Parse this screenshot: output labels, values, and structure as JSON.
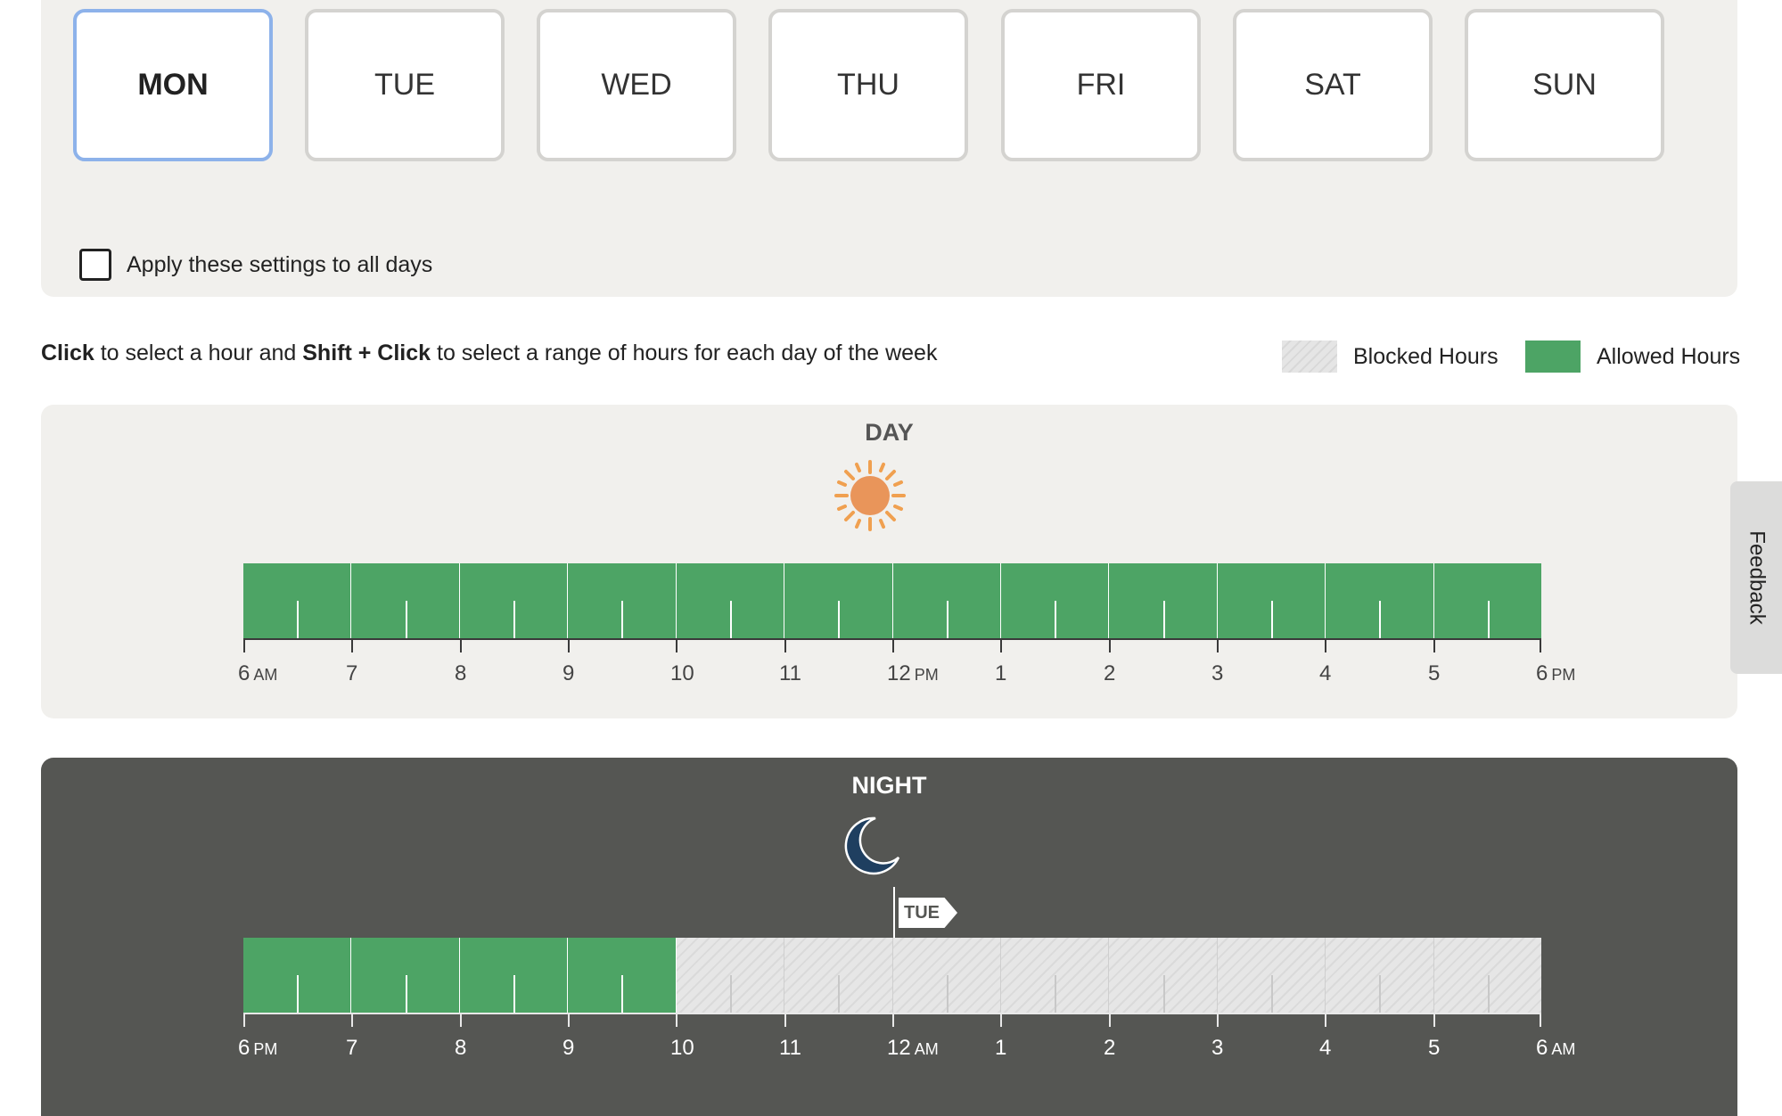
{
  "days": {
    "buttons": [
      {
        "label": "MON",
        "selected": true
      },
      {
        "label": "TUE",
        "selected": false
      },
      {
        "label": "WED",
        "selected": false
      },
      {
        "label": "THU",
        "selected": false
      },
      {
        "label": "FRI",
        "selected": false
      },
      {
        "label": "SAT",
        "selected": false
      },
      {
        "label": "SUN",
        "selected": false
      }
    ],
    "apply_all_label": "Apply these settings to all days",
    "apply_all_checked": false
  },
  "instructions": {
    "click": "Click",
    "part1": " to select a hour and ",
    "shift_click": "Shift + Click",
    "part2": " to select a range of hours for each day of the week"
  },
  "legend": {
    "blocked_label": "Blocked Hours",
    "allowed_label": "Allowed Hours",
    "allowed_color": "#4da465",
    "blocked_color": "#e5e5e5"
  },
  "day_panel": {
    "title": "DAY",
    "icon": "sun-icon",
    "hours": [
      "allowed",
      "allowed",
      "allowed",
      "allowed",
      "allowed",
      "allowed",
      "allowed",
      "allowed",
      "allowed",
      "allowed",
      "allowed",
      "allowed"
    ],
    "tick_labels": [
      {
        "num": "6",
        "ap": "AM"
      },
      {
        "num": "7",
        "ap": ""
      },
      {
        "num": "8",
        "ap": ""
      },
      {
        "num": "9",
        "ap": ""
      },
      {
        "num": "10",
        "ap": ""
      },
      {
        "num": "11",
        "ap": ""
      },
      {
        "num": "12",
        "ap": "PM"
      },
      {
        "num": "1",
        "ap": ""
      },
      {
        "num": "2",
        "ap": ""
      },
      {
        "num": "3",
        "ap": ""
      },
      {
        "num": "4",
        "ap": ""
      },
      {
        "num": "5",
        "ap": ""
      },
      {
        "num": "6",
        "ap": "PM"
      }
    ]
  },
  "night_panel": {
    "title": "NIGHT",
    "icon": "moon-icon",
    "next_day_marker": "TUE",
    "hours": [
      "allowed",
      "allowed",
      "allowed",
      "allowed",
      "blocked",
      "blocked",
      "blocked",
      "blocked",
      "blocked",
      "blocked",
      "blocked",
      "blocked"
    ],
    "tick_labels": [
      {
        "num": "6",
        "ap": "PM"
      },
      {
        "num": "7",
        "ap": ""
      },
      {
        "num": "8",
        "ap": ""
      },
      {
        "num": "9",
        "ap": ""
      },
      {
        "num": "10",
        "ap": ""
      },
      {
        "num": "11",
        "ap": ""
      },
      {
        "num": "12",
        "ap": "AM"
      },
      {
        "num": "1",
        "ap": ""
      },
      {
        "num": "2",
        "ap": ""
      },
      {
        "num": "3",
        "ap": ""
      },
      {
        "num": "4",
        "ap": ""
      },
      {
        "num": "5",
        "ap": ""
      },
      {
        "num": "6",
        "ap": "AM"
      }
    ]
  },
  "feedback": {
    "label": "Feedback"
  }
}
